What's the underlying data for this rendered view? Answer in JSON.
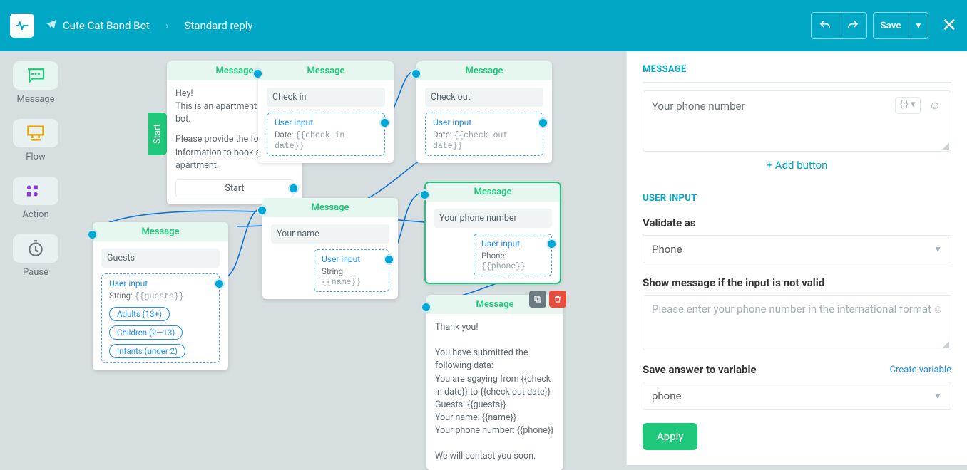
{
  "header": {
    "bot_name": "Cute Cat Band Bot",
    "page": "Standard reply",
    "save": "Save"
  },
  "tools": {
    "message": "Message",
    "flow": "Flow",
    "action": "Action",
    "pause": "Pause"
  },
  "start_label": "Start",
  "nodes": {
    "n1": {
      "title": "Message",
      "text_top": "Hey!\nThis is an apartment rental bot.",
      "text_bottom": "Please provide the following information to book an apartment.",
      "start_btn": "Start"
    },
    "n2": {
      "title": "Message",
      "prompt": "Check in",
      "ui_title": "User input",
      "ui_line": "Date: {{check in date}}"
    },
    "n3": {
      "title": "Message",
      "prompt": "Check out",
      "ui_title": "User input",
      "ui_line": "Date: {{check out date}}"
    },
    "n4": {
      "title": "Message",
      "prompt": "Guests",
      "ui_title": "User input",
      "ui_line": "String: {{guests}}",
      "chips": [
        "Adults (13+)",
        "Children (2—13)",
        "Infants (under 2)"
      ]
    },
    "n5": {
      "title": "Message",
      "prompt": "Your name",
      "ui_title": "User input",
      "ui_line": "String: {{name}}"
    },
    "n6": {
      "title": "Message",
      "prompt": "Your phone number",
      "ui_title": "User input",
      "ui_line": "Phone: {{phone}}"
    },
    "n7": {
      "title": "Message",
      "body": "Thank you!\n\nYou have submitted the following data:\nYou are sgaying from {{check in date}} to {{check out date}}\nGuests:  {{guests}}\nYour name:  {{name}}\nYour phone number:  {{phone}}\n\nWe will contact you soon."
    }
  },
  "right": {
    "section_message": "MESSAGE",
    "message_text": "Your phone number",
    "var_btn": "{·} ▾",
    "add_button": "+ Add button",
    "section_userinput": "USER INPUT",
    "validate_label": "Validate as",
    "validate_value": "Phone",
    "invalid_label": "Show message if the input is not valid",
    "invalid_placeholder": "Please enter your phone number in the international format",
    "save_label": "Save answer to variable",
    "create_var": "Create variable",
    "variable_value": "phone",
    "apply": "Apply"
  }
}
